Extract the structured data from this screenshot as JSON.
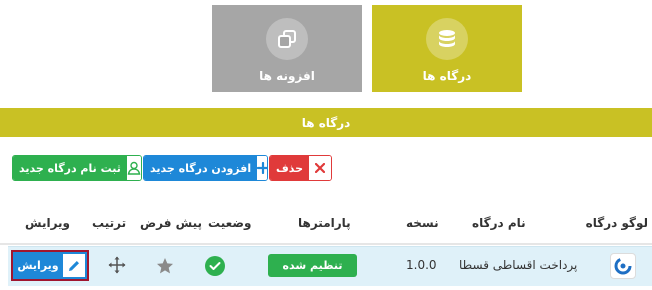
{
  "tiles": {
    "gateways": {
      "label": "درگاه ها",
      "icon": "database-icon",
      "color": "#c9c124"
    },
    "addons": {
      "label": "افزونه ها",
      "icon": "copy-icon",
      "color": "#a6a6a6"
    }
  },
  "section": {
    "title": "درگاه ها"
  },
  "actions": {
    "delete_label": "حذف",
    "add_label": "افزودن درگاه جدید",
    "register_label": "ثبت نام درگاه جدید"
  },
  "table": {
    "headers": {
      "logo": "لوگو درگاه",
      "name": "نام درگاه",
      "version": "نسخه",
      "params": "پارامترها",
      "status": "وضعیت",
      "default": "پیش فرض",
      "order": "ترتیب",
      "edit": "ویرایش"
    },
    "rows": [
      {
        "name": "پرداخت اقساطی قسطا",
        "version": "1.0.0",
        "params_label": "تنظیم شده",
        "status": "active",
        "is_default": false,
        "edit_label": "ویرایش"
      }
    ]
  },
  "colors": {
    "accent": "#c9c124",
    "danger": "#e03a3a",
    "primary": "#1e88d8",
    "success": "#2eb04f",
    "row_highlight": "#dff1f9"
  }
}
